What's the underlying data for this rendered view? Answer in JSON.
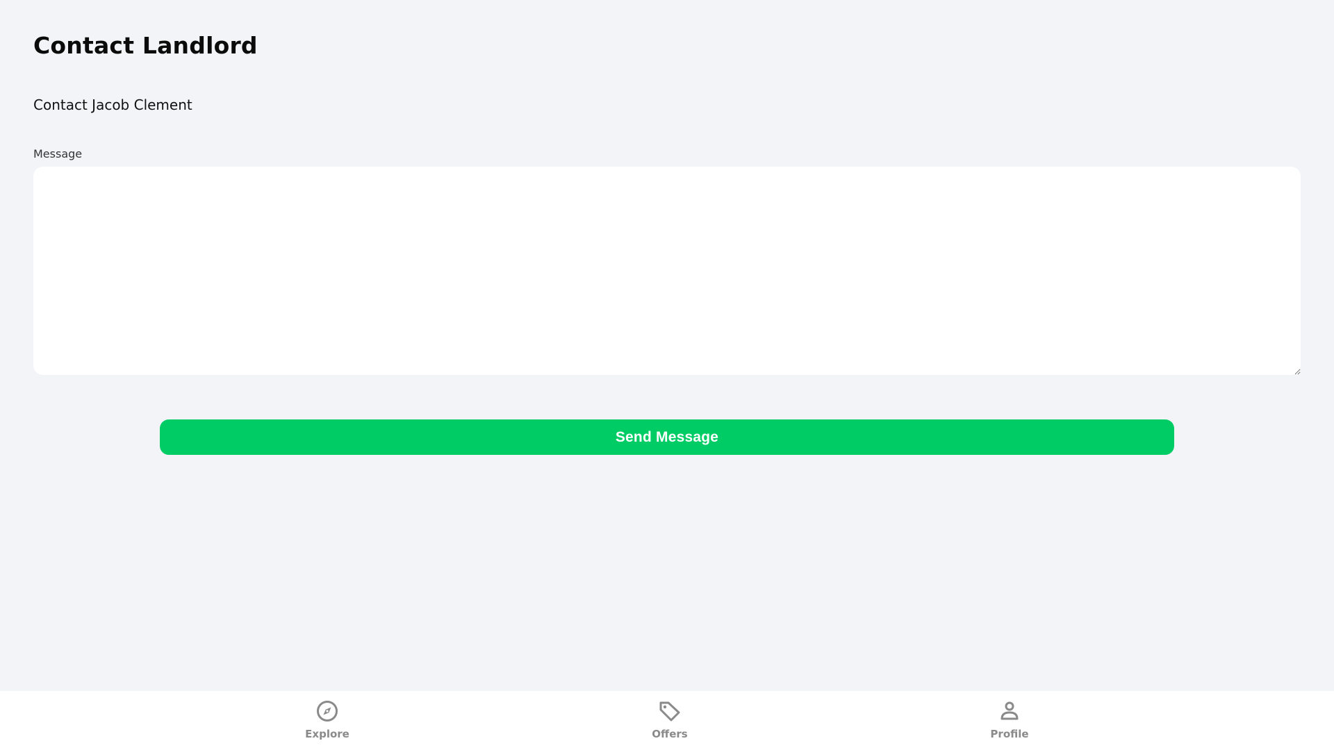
{
  "header": {
    "title": "Contact Landlord",
    "subtitle": "Contact Jacob Clement"
  },
  "form": {
    "message_label": "Message",
    "message_value": "",
    "message_placeholder": "",
    "send_label": "Send Message"
  },
  "nav": {
    "items": [
      {
        "label": "Explore",
        "icon": "compass-icon"
      },
      {
        "label": "Offers",
        "icon": "tag-icon"
      },
      {
        "label": "Profile",
        "icon": "person-icon"
      }
    ]
  },
  "colors": {
    "background": "#f2f4f7",
    "accent": "#00cc66",
    "nav_icon": "#8a8a8a"
  }
}
